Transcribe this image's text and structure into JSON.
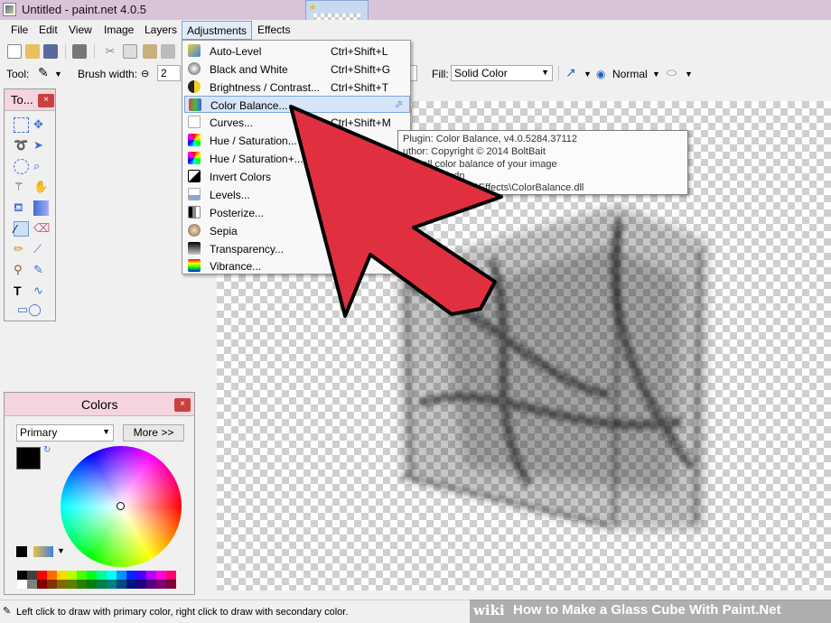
{
  "window": {
    "title": "Untitled - paint.net 4.0.5"
  },
  "menubar": {
    "items": [
      "File",
      "Edit",
      "View",
      "Image",
      "Layers",
      "Adjustments",
      "Effects"
    ],
    "open": "Adjustments"
  },
  "options_bar": {
    "tool_label": "Tool:",
    "brush_width_label": "Brush width:",
    "brush_width_value": "2",
    "fill_label": "Fill:",
    "fill_value": "Solid Color",
    "blend_mode": "Normal"
  },
  "adjustments_menu": [
    {
      "label": "Auto-Level",
      "shortcut": "Ctrl+Shift+L",
      "icon": "auto-level-icon"
    },
    {
      "label": "Black and White",
      "shortcut": "Ctrl+Shift+G",
      "icon": "black-and-white-icon"
    },
    {
      "label": "Brightness / Contrast...",
      "shortcut": "Ctrl+Shift+T",
      "icon": "brightness-contrast-icon"
    },
    {
      "label": "Color Balance...",
      "shortcut": "",
      "icon": "color-balance-icon",
      "highlighted": true,
      "plugin": true
    },
    {
      "label": "Curves...",
      "shortcut": "Ctrl+Shift+M",
      "icon": "curves-icon"
    },
    {
      "label": "Hue / Saturation...",
      "shortcut": "",
      "icon": "hue-saturation-icon"
    },
    {
      "label": "Hue / Saturation+...",
      "shortcut": "",
      "icon": "hue-saturation-plus-icon"
    },
    {
      "label": "Invert Colors",
      "shortcut": "",
      "icon": "invert-colors-icon"
    },
    {
      "label": "Levels...",
      "shortcut": "",
      "icon": "levels-icon"
    },
    {
      "label": "Posterize...",
      "shortcut": "",
      "icon": "posterize-icon"
    },
    {
      "label": "Sepia",
      "shortcut": "",
      "icon": "sepia-icon"
    },
    {
      "label": "Transparency...",
      "shortcut": "",
      "icon": "transparency-icon"
    },
    {
      "label": "Vibrance...",
      "shortcut": "",
      "icon": "vibrance-icon"
    }
  ],
  "tooltip": {
    "line1": "Plugin: Color Balance, v4.0.5284.37112",
    "line2": "uthor: Copyright © 2014 BoltBait",
    "line3": "overall color balance of your image",
    "line4": "ltbait.com/pdn",
    "line5": "m Files\\paint.net\\Effects\\ColorBalance.dll"
  },
  "tools_panel": {
    "title": "To..."
  },
  "colors_panel": {
    "title": "Colors",
    "mode": "Primary",
    "more_button": "More >>"
  },
  "status_bar": {
    "message": "Left click to draw with primary color, right click to draw with secondary color."
  },
  "watermark": {
    "brand": "wiki",
    "text": "How to Make a Glass Cube With Paint.Net"
  },
  "colors": {
    "title_bar": "#d9c3d9",
    "panel_header": "#f4d4de",
    "menu_highlight": "#d6e5f7",
    "pointer_arrow": "#e03040"
  }
}
